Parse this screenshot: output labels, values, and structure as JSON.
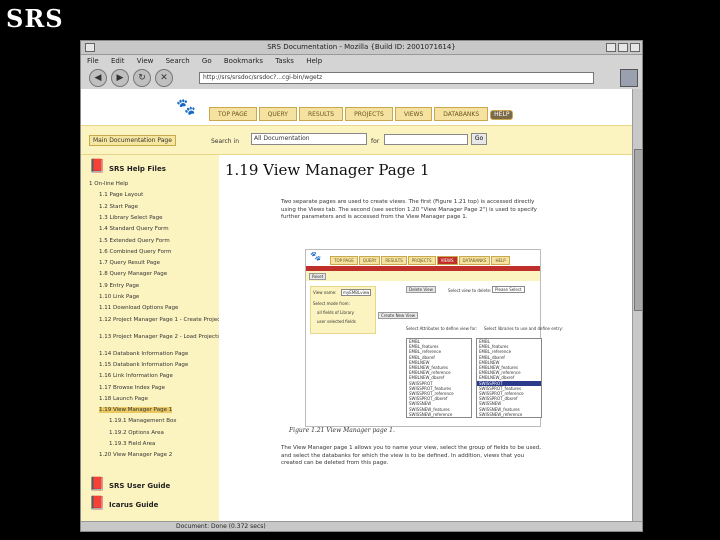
{
  "slide_title": "SRS",
  "browser": {
    "title": "SRS Documentation - Mozilla {Build ID: 2001071614}",
    "menu": [
      "File",
      "Edit",
      "View",
      "Search",
      "Go",
      "Bookmarks",
      "Tasks",
      "Help"
    ],
    "url": "http://srs/srsdoc/srsdoc?...cgi-bin/wgetz",
    "status": "Document: Done (0.372 secs)"
  },
  "srs": {
    "tabs": [
      "TOP PAGE",
      "QUERY",
      "RESULTS",
      "PROJECTS",
      "VIEWS",
      "DATABANKS"
    ],
    "help_tab": "HELP",
    "main_doc_label": "Main Documentation Page",
    "search_in_label": "Search in",
    "search_select_value": "All Documentation",
    "for_label": "for",
    "go_label": "Go"
  },
  "sidebar": {
    "help_files": "SRS Help Files",
    "items": [
      "1 On-line Help",
      "1.1 Page Layout",
      "1.2 Start Page",
      "1.3 Library Select Page",
      "1.4 Standard Query Form",
      "1.5 Extended Query Form",
      "1.6 Combined Query Form",
      "1.7 Query Result Page",
      "1.8 Query Manager Page",
      "1.9 Entry Page",
      "1.10 Link Page",
      "1.11 Download Options Page",
      "1.12 Project Manager Page 1 - Create Projects",
      "1.13 Project Manager Page 2 - Load Projects",
      "1.14 Databank Information Page",
      "1.15 Databank Information Page",
      "1.16 Link Information Page",
      "1.17 Browse Index Page",
      "1.18 Launch Page",
      "1.19 View Manager Page 1",
      "1.19.1 Management Box",
      "1.19.2 Options Area",
      "1.19.3 Field Area",
      "1.20 View Manager Page 2"
    ],
    "selected_index": 19,
    "user_guide": "SRS User Guide",
    "icarus_guide": "Icarus Guide"
  },
  "content": {
    "heading": "1.19 View Manager Page 1",
    "para1": "Two separate pages are used to create views. The first (Figure 1.21 top) is accessed directly using the Views tab. The second (see section 1.20 \"View Manager Page 2\") is used to specify further parameters and is accessed from the View Manager page 1.",
    "figure": {
      "tabs": [
        "TOP PAGE",
        "QUERY",
        "RESULTS",
        "PROJECTS",
        "VIEWS",
        "DATABANKS"
      ],
      "active_tab": "VIEWS",
      "help": "HELP",
      "reset": "Reset",
      "view_name_label": "View name:",
      "view_name_value": "myEMBLview",
      "delete_label": "Delete View",
      "select_label": "Select view to delete:",
      "select_value": "Please Select",
      "select_mode": "Select mode from:",
      "option1": "all fields of Library",
      "option2": "user selected fields",
      "create_label": "Create New View",
      "attr_head": "Select Attributes to define view for:",
      "lib_head": "Select libraries to use and define entry:",
      "list_left": [
        "EMBL",
        "EMBL_features",
        "EMBL_reference",
        "EMBL_dbxref",
        "EMBLNEW",
        "EMBLNEW_features",
        "EMBLNEW_reference",
        "EMBLNEW_dbxref",
        "SWISSPROT",
        "SWISSPROT_features",
        "SWISSPROT_reference",
        "SWISSPROT_dbxref",
        "SWISSNEW",
        "SWISSNEW_features",
        "SWISSNEW_reference"
      ],
      "list_right": [
        "EMBL",
        "EMBL_features",
        "EMBL_reference",
        "EMBL_dbxref",
        "EMBLNEW",
        "EMBLNEW_features",
        "EMBLNEW_reference",
        "EMBLNEW_dbxref",
        "SWISSPROT",
        "SWISSPROT_features",
        "SWISSPROT_reference",
        "SWISSPROT_dbxref",
        "SWISSNEW",
        "SWISSNEW_features",
        "SWISSNEW_reference"
      ],
      "list_selected_index": 8
    },
    "caption": "Figure 1.21 View Manager page 1.",
    "para2": "The View Manager page 1 allows you to name your view, select the group of fields to be used, and select the databanks for which the view is to be defined. In addition, views that you created can be deleted from this page."
  }
}
